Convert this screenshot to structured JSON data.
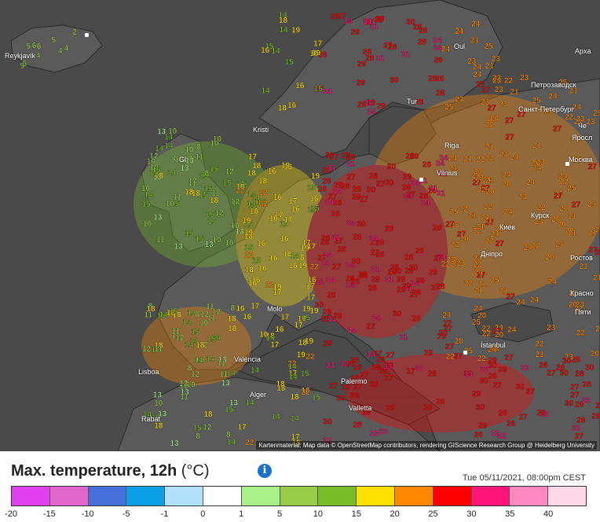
{
  "title": "Max. temperature, 12h",
  "unit": "(°C)",
  "timestamp": "Tue 05/11/2021, 08:00pm CEST",
  "attribution": "Kartenmaterial: Map data © OpenStreetMap contributors, rendering GIScience Research Group @ Heidelberg University",
  "icons": {
    "info": "info-icon"
  },
  "legend": {
    "colors": [
      "#e040f0",
      "#e066cc",
      "#4470d8",
      "#0aa0e8",
      "#b0e0fa",
      "#ffffff",
      "#a8f088",
      "#98cc48",
      "#78bc28",
      "#ffe000",
      "#ff8800",
      "#ff0000",
      "#ff1477",
      "#ff88c0",
      "#ffd8e8"
    ],
    "ticks": [
      "-20",
      "-15",
      "-10",
      "-5",
      "-1",
      "0",
      "1",
      "5",
      "10",
      "15",
      "20",
      "25",
      "30",
      "35",
      "40"
    ]
  },
  "cities": [
    {
      "name": "Reykjavík"
    },
    {
      "name": "Kristi"
    },
    {
      "name": "Oul"
    },
    {
      "name": "Tur"
    },
    {
      "name": "Петрозаводск"
    },
    {
      "name": "Санкт-Петербург"
    },
    {
      "name": "Че"
    },
    {
      "name": "Яросл"
    },
    {
      "name": "Moсква"
    },
    {
      "name": "Gl"
    },
    {
      "name": "Riga"
    },
    {
      "name": "Vilnius"
    },
    {
      "name": "Курск"
    },
    {
      "name": "Киев"
    },
    {
      "name": "Днiпро"
    },
    {
      "name": "Ростов"
    },
    {
      "name": "Красно"
    },
    {
      "name": "Пяти"
    },
    {
      "name": "Molo"
    },
    {
      "name": "València"
    },
    {
      "name": "Lisboa"
    },
    {
      "name": "Alger"
    },
    {
      "name": "Palermo"
    },
    {
      "name": "Valletta"
    },
    {
      "name": "Rabat"
    },
    {
      "name": "İstanbul"
    },
    {
      "name": "Apxa"
    }
  ],
  "station_values": [
    {
      "v": "4",
      "c": "#98cc48"
    },
    {
      "v": "2",
      "c": "#98cc48"
    },
    {
      "v": "6",
      "c": "#98cc48"
    },
    {
      "v": "5",
      "c": "#98cc48"
    },
    {
      "v": "9",
      "c": "#98cc48"
    },
    {
      "v": "13",
      "c": "#a8f088"
    },
    {
      "v": "16",
      "c": "#ffe000"
    },
    {
      "v": "17",
      "c": "#ffe000"
    },
    {
      "v": "21",
      "c": "#ff8800"
    },
    {
      "v": "23",
      "c": "#ff8800"
    },
    {
      "v": "24",
      "c": "#ff8800"
    },
    {
      "v": "25",
      "c": "#ff8800"
    },
    {
      "v": "27",
      "c": "#ff0000"
    },
    {
      "v": "28",
      "c": "#ff0000"
    },
    {
      "v": "30",
      "c": "#ff0000"
    },
    {
      "v": "31",
      "c": "#ff1477"
    },
    {
      "v": "33",
      "c": "#ff1477"
    },
    {
      "v": "37",
      "c": "#ff1477"
    },
    {
      "v": "15",
      "c": "#78bc28"
    },
    {
      "v": "12",
      "c": "#98cc48"
    },
    {
      "v": "19",
      "c": "#ffe000"
    },
    {
      "v": "20",
      "c": "#ff8800"
    },
    {
      "v": "22",
      "c": "#ff8800"
    },
    {
      "v": "26",
      "c": "#ff0000"
    },
    {
      "v": "18",
      "c": "#ffe000"
    },
    {
      "v": "14",
      "c": "#78bc28"
    },
    {
      "v": "29",
      "c": "#ff0000"
    },
    {
      "v": "10",
      "c": "#98cc48"
    },
    {
      "v": "32",
      "c": "#ff1477"
    },
    {
      "v": "34",
      "c": "#ff1477"
    },
    {
      "v": "11",
      "c": "#98cc48"
    },
    {
      "v": "8",
      "c": "#98cc48"
    }
  ]
}
